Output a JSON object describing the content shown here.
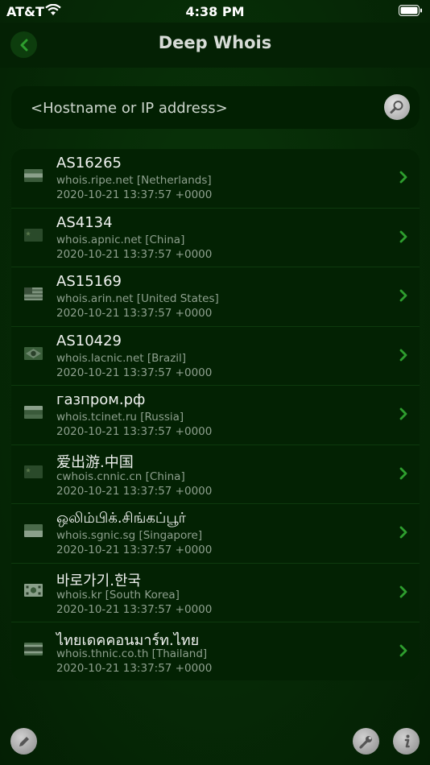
{
  "status_bar": {
    "carrier": "AT&T",
    "time": "4:38 PM"
  },
  "nav": {
    "title": "Deep Whois",
    "back_icon": "chevron-left-icon"
  },
  "search": {
    "placeholder": "<Hostname or IP address>",
    "value": "",
    "button_icon": "magnifier-icon"
  },
  "colors": {
    "background": "#052705",
    "accent": "#2e9e2e"
  },
  "results": [
    {
      "title": "AS16265",
      "server": "whois.ripe.net [Netherlands]",
      "date": "2020-10-21 13:37:57 +0000",
      "flag": "netherlands-flag-icon"
    },
    {
      "title": "AS4134",
      "server": "whois.apnic.net [China]",
      "date": "2020-10-21 13:37:57 +0000",
      "flag": "china-flag-icon"
    },
    {
      "title": "AS15169",
      "server": "whois.arin.net [United States]",
      "date": "2020-10-21 13:37:57 +0000",
      "flag": "us-flag-icon"
    },
    {
      "title": "AS10429",
      "server": "whois.lacnic.net [Brazil]",
      "date": "2020-10-21 13:37:57 +0000",
      "flag": "brazil-flag-icon"
    },
    {
      "title": "газпром.рф",
      "server": "whois.tcinet.ru [Russia]",
      "date": "2020-10-21 13:37:57 +0000",
      "flag": "russia-flag-icon"
    },
    {
      "title": "爱出游.中国",
      "server": "cwhois.cnnic.cn [China]",
      "date": "2020-10-21 13:37:57 +0000",
      "flag": "china-flag-icon"
    },
    {
      "title": "ஒலிம்பிக்.சிங்கப்பூர்",
      "server": "whois.sgnic.sg [Singapore]",
      "date": "2020-10-21 13:37:57 +0000",
      "flag": "singapore-flag-icon"
    },
    {
      "title": "바로가기.한국",
      "server": "whois.kr [South Korea]",
      "date": "2020-10-21 13:37:57 +0000",
      "flag": "south-korea-flag-icon"
    },
    {
      "title": "ไทยเดคคอนมาร์ท.ไทย",
      "server": "whois.thnic.co.th [Thailand]",
      "date": "2020-10-21 13:37:57 +0000",
      "flag": "thailand-flag-icon"
    }
  ],
  "toolbar": {
    "edit_icon": "pencil-icon",
    "settings_icon": "wrench-icon",
    "info_icon": "info-icon"
  }
}
